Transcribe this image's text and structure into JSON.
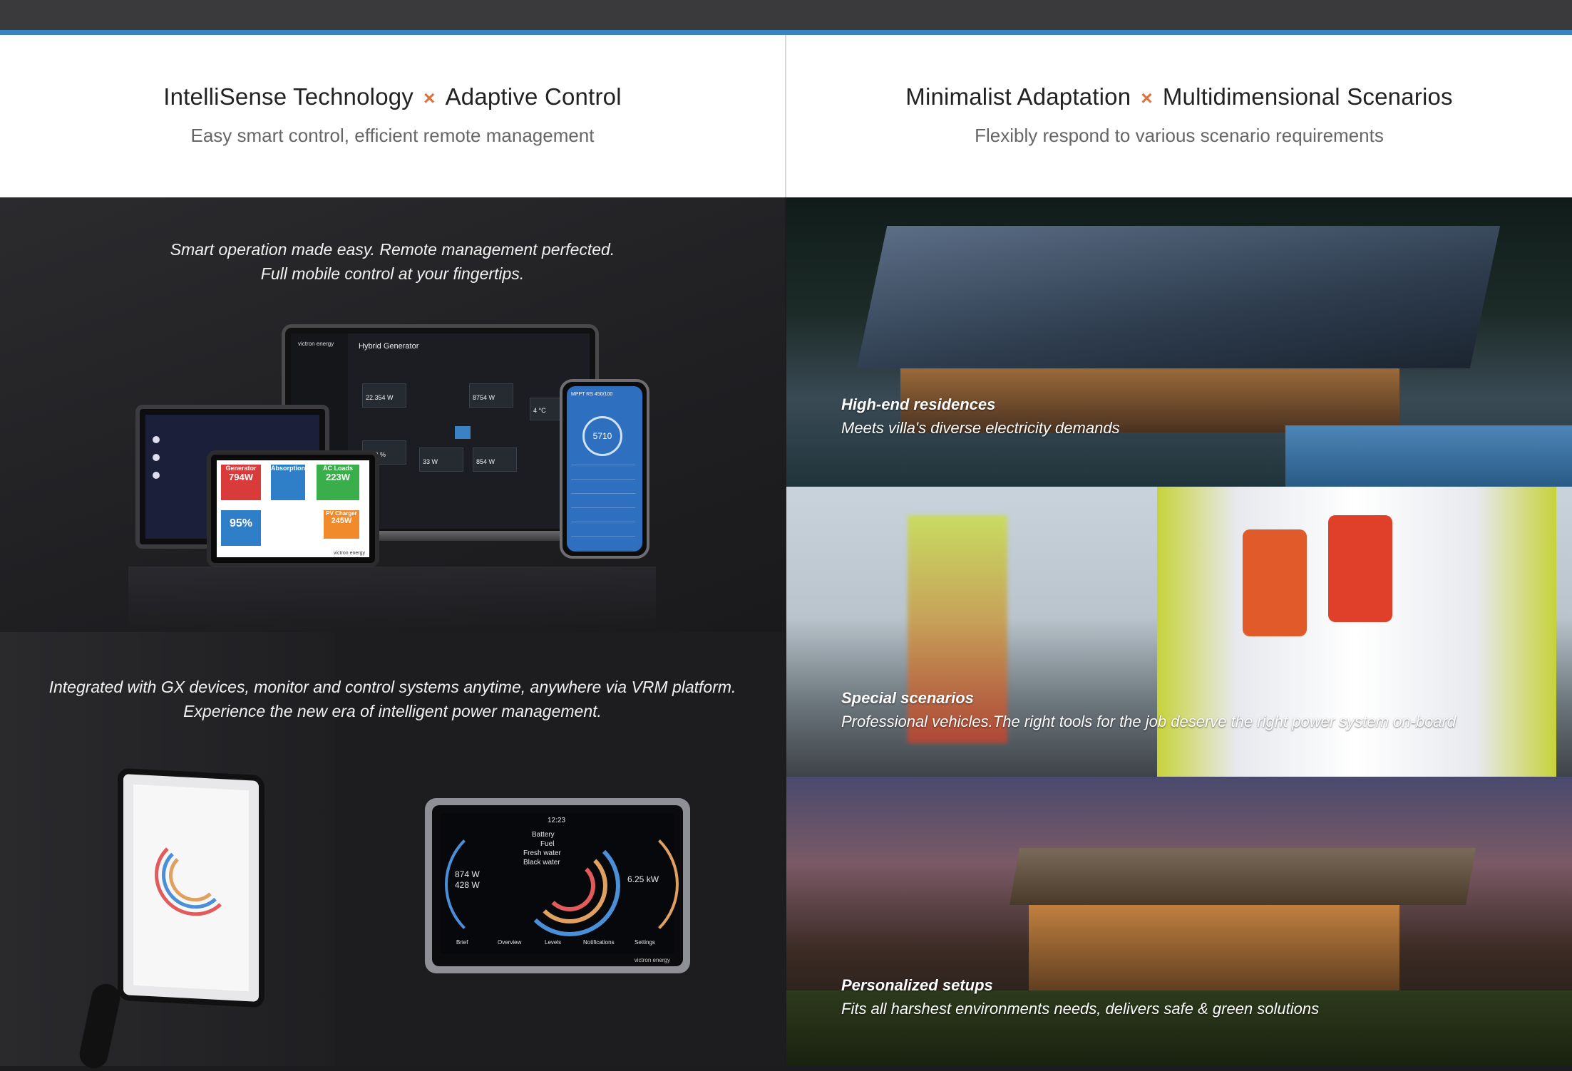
{
  "header": {
    "left": {
      "title_a": "IntelliSense Technology",
      "title_sep": "×",
      "title_b": "Adaptive Control",
      "subtitle": "Easy smart control, efficient remote management"
    },
    "right": {
      "title_a": "Minimalist Adaptation",
      "title_sep": "×",
      "title_b": "Multidimensional Scenarios",
      "subtitle": "Flexibly respond to various scenario requirements"
    }
  },
  "left_panel": {
    "caption_top_line1": "Smart operation made easy. Remote management perfected.",
    "caption_top_line2": "Full mobile control at your fingertips.",
    "caption_mid_line1": "Integrated with GX devices, monitor and control systems anytime, anywhere via VRM platform.",
    "caption_mid_line2": "Experience the new era of intelligent power management.",
    "laptop": {
      "brand": "victron energy",
      "header": "Hybrid Generator",
      "val1": "22.354 W",
      "val2": "8754 W",
      "val3": "20.0 %",
      "val4": "33 W",
      "val5": "854 W",
      "val6": "4 °C"
    },
    "tablet": {
      "generator": "Generator",
      "generator_val": "794W",
      "absorption": "Absorption",
      "ac_loads": "AC Loads",
      "ac_loads_val": "223W",
      "battery_val": "95%",
      "pv_charger": "PV Charger",
      "pv_charger_val": "245W",
      "brand": "victron energy"
    },
    "phone": {
      "title": "MPPT RS 450/100",
      "gauge": "5710"
    },
    "gx_touch": {
      "time": "12:23",
      "battery": "Battery",
      "fuel": "Fuel",
      "fresh_water": "Fresh water",
      "black_water": "Black water",
      "left_val1": "874 W",
      "left_val2": "428 W",
      "right_val": "6.25 kW",
      "nav": [
        "Brief",
        "Overview",
        "Levels",
        "Notifications",
        "Settings"
      ],
      "brand": "victron energy"
    }
  },
  "scenarios": [
    {
      "title": "High-end residences",
      "desc": "Meets villa's diverse electricity demands"
    },
    {
      "title": "Special scenarios",
      "desc": "Professional vehicles.The right tools for the job deserve the right power system on-board"
    },
    {
      "title": "Personalized setups",
      "desc": "Fits all harshest environments needs, delivers safe & green solutions"
    }
  ],
  "colors": {
    "accent_blue": "#3b82c4",
    "separator_orange": "#e0713a",
    "top_bar": "#3a3a3c"
  }
}
